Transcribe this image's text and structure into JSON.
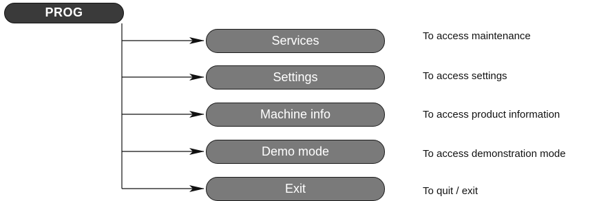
{
  "root": {
    "label": "PROG"
  },
  "items": [
    {
      "label": "Services",
      "description": "To access maintenance"
    },
    {
      "label": "Settings",
      "description": "To access settings"
    },
    {
      "label": "Machine info",
      "description": "To access product information"
    },
    {
      "label": "Demo mode",
      "description": "To access demonstration mode"
    },
    {
      "label": "Exit",
      "description": "To quit / exit"
    }
  ],
  "colors": {
    "root_fill": "#3a3a3a",
    "item_fill": "#7a7a7a",
    "outline": "#1a1a1a",
    "connector": "#111111"
  }
}
